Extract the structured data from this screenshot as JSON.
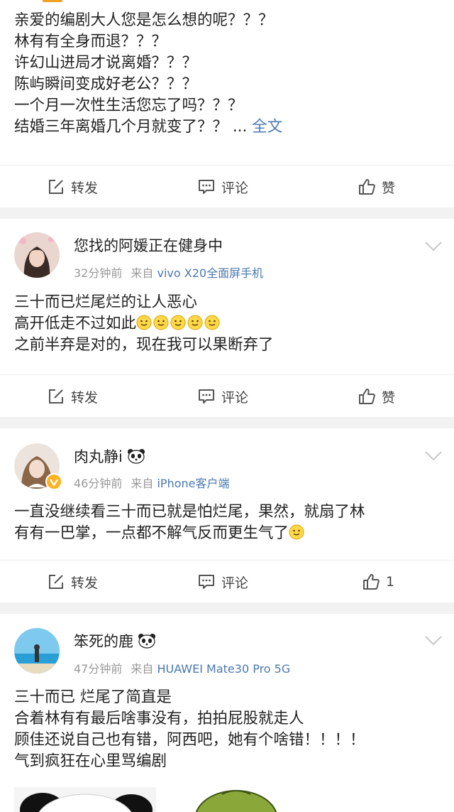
{
  "posts": [
    {
      "lines": [
        "亲爱的编剧大人您是怎么想的呢？？？",
        "林有有全身而退？？？",
        "许幻山进局才说离婚？？？",
        "陈屿瞬间变成好老公？？？",
        "一个月一次性生活您忘了吗？？？",
        "结婚三年离婚几个月就变了？？ ... "
      ],
      "full_text": "全文",
      "actions": {
        "forward": "转发",
        "comment": "评论",
        "like": "赞"
      }
    },
    {
      "username": "您找的阿媛正在健身中",
      "time": "32分钟前",
      "from": "来自",
      "source": "vivo X20全面屏手机",
      "lines": [
        "三十而已烂尾烂的让人恶心",
        "高开低走不过如此",
        "之前半弃是对的，现在我可以果断弃了"
      ],
      "actions": {
        "forward": "转发",
        "comment": "评论",
        "like": "赞"
      }
    },
    {
      "username": "肉丸静i",
      "time": "46分钟前",
      "from": "来自",
      "source": "iPhone客户端",
      "lines": [
        "一直没继续看三十而已就是怕烂尾，果然，就扇了林",
        "有有一巴掌，一点都不解气反而更生气了"
      ],
      "actions": {
        "forward": "转发",
        "comment": "评论",
        "like": "1"
      }
    },
    {
      "username": "笨死的鹿",
      "time": "47分钟前",
      "from": "来自",
      "source": "HUAWEI Mate30 Pro 5G",
      "lines": [
        "三十而已 烂尾了简直是",
        "合着林有有最后啥事没有，拍拍屁股就走人",
        "顾佳还说自己也有错，阿西吧，她有个啥错！！！！",
        "气到疯狂在心里骂编剧"
      ]
    }
  ],
  "icons": {
    "forward": "edit-share-icon",
    "comment": "comment-bubble-icon",
    "like": "thumb-up-icon",
    "more": "chevron-down-icon",
    "emoji": "smile-emoji-icon",
    "panda": "panda-emoji-icon",
    "verified": "verified-badge-icon"
  },
  "colors": {
    "link": "#4a78b0",
    "separator": "#f2f2f2",
    "meta": "#999999",
    "accent": "#f0a020",
    "verified": "#ffb21e"
  }
}
